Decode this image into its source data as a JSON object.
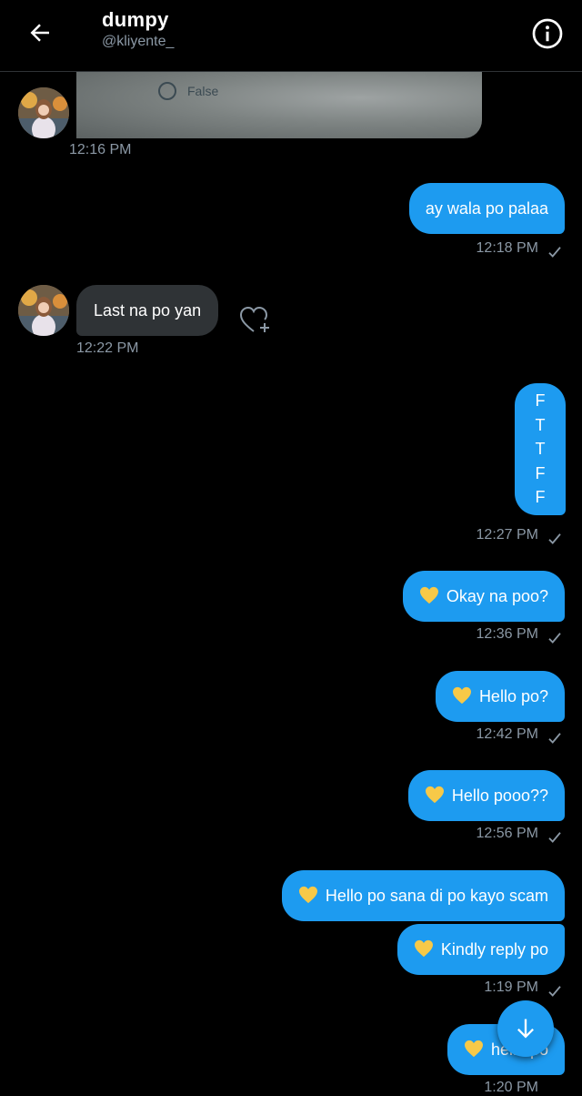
{
  "header": {
    "name": "dumpy",
    "handle": "@kliyente_"
  },
  "image_message": {
    "option_text": "False",
    "time": "12:16 PM"
  },
  "messages": [
    {
      "from": "me",
      "text": "ay wala po palaa",
      "time": "12:18 PM"
    },
    {
      "from": "them",
      "text": "Last na po yan",
      "time": "12:22 PM"
    },
    {
      "from": "me",
      "lines": [
        "F",
        "T",
        "T",
        "F",
        "F"
      ],
      "time": "12:27 PM"
    },
    {
      "from": "me",
      "text": "Okay na poo?",
      "time": "12:36 PM"
    },
    {
      "from": "me",
      "text": "Hello po?",
      "time": "12:42 PM"
    },
    {
      "from": "me",
      "text": "Hello pooo??",
      "time": "12:56 PM"
    },
    {
      "from": "me",
      "text": "Hello po sana di po kayo scam"
    },
    {
      "from": "me",
      "text": "Kindly reply po",
      "time": "1:19 PM"
    },
    {
      "from": "me",
      "text": "hello po",
      "time": "1:20 PM"
    }
  ],
  "colors": {
    "background": "#000000",
    "outgoing_bubble": "#1d9bf0",
    "incoming_bubble": "#2f3336",
    "timestamp": "#8b98a5",
    "heart_emoji": "#f7c948"
  },
  "icons": {
    "back": "arrow-left-icon",
    "info": "info-icon",
    "react": "heart-plus-icon",
    "sent": "check-icon",
    "scroll": "arrow-down-icon",
    "emoji": "yellow-heart-icon"
  }
}
